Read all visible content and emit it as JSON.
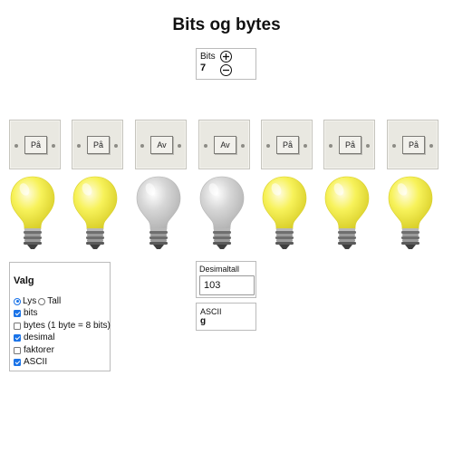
{
  "page": {
    "title": "Bits og bytes"
  },
  "bits": {
    "label": "Bits",
    "value": "7",
    "increment_icon": "plus-icon",
    "decrement_icon": "minus-icon"
  },
  "switches": [
    {
      "label": "På",
      "state": "on"
    },
    {
      "label": "På",
      "state": "on"
    },
    {
      "label": "Av",
      "state": "off"
    },
    {
      "label": "Av",
      "state": "off"
    },
    {
      "label": "På",
      "state": "on"
    },
    {
      "label": "På",
      "state": "on"
    },
    {
      "label": "På",
      "state": "on"
    }
  ],
  "bulbs": [
    {
      "state": "on"
    },
    {
      "state": "on"
    },
    {
      "state": "off"
    },
    {
      "state": "off"
    },
    {
      "state": "on"
    },
    {
      "state": "on"
    },
    {
      "state": "on"
    }
  ],
  "options": {
    "title": "Valg",
    "display_mode": {
      "selected": "Lys",
      "choices": [
        "Lys",
        "Tall"
      ]
    },
    "checkboxes": [
      {
        "label": "bits",
        "checked": true
      },
      {
        "label": "bytes (1 byte = 8 bits)",
        "checked": false
      },
      {
        "label": "desimal",
        "checked": true
      },
      {
        "label": "faktorer",
        "checked": false
      },
      {
        "label": "ASCII",
        "checked": true
      }
    ]
  },
  "decimal": {
    "label": "Desimaltall",
    "value": "103"
  },
  "ascii": {
    "label": "ASCII",
    "value": "g"
  },
  "colors": {
    "bulb_on": "#f7f25a",
    "bulb_off": "#d6d6d6",
    "switch_plate": "#e9e8e1",
    "accent": "#1a73e8"
  }
}
